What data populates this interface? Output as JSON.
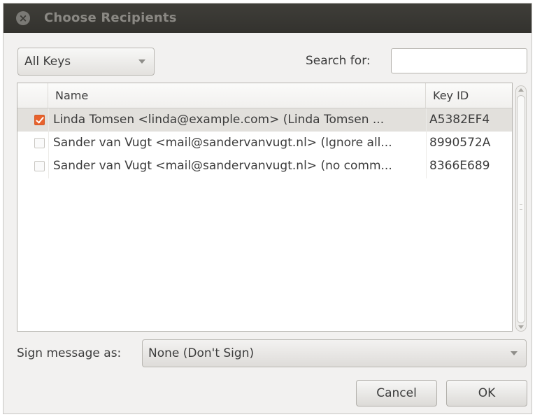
{
  "window": {
    "title": "Choose Recipients",
    "close_glyph": "×"
  },
  "filter": {
    "selected": "All Keys"
  },
  "search": {
    "label": "Search for:",
    "value": ""
  },
  "list": {
    "columns": [
      "Name",
      "Key ID"
    ],
    "rows": [
      {
        "checked": true,
        "name": "Linda Tomsen <linda@example.com> (Linda Tomsen ...",
        "key_id": "A5382EF4"
      },
      {
        "checked": false,
        "name": "Sander van Vugt <mail@sandervanvugt.nl> (Ignore all...",
        "key_id": "8990572A"
      },
      {
        "checked": false,
        "name": "Sander van Vugt <mail@sandervanvugt.nl> (no comm...",
        "key_id": "8366E689"
      }
    ]
  },
  "sign": {
    "label": "Sign message as:",
    "selected": "None (Don't Sign)"
  },
  "buttons": {
    "cancel": "Cancel",
    "ok": "OK"
  },
  "colors": {
    "titlebar": "#3a3935",
    "checkbox_accent": "#e8622d",
    "window_bg": "#f2f1f0",
    "selected_row": "#e2e0dc"
  },
  "icons": {
    "close": "close-icon",
    "checkbox": "checkbox-icon",
    "dropdown": "chevron-down-icon"
  }
}
